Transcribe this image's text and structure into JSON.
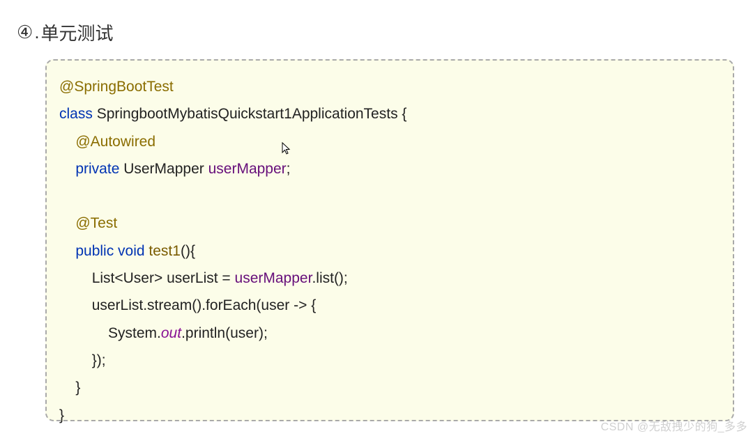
{
  "heading": {
    "number": "④",
    "dot": ".",
    "title": "单元测试"
  },
  "code": {
    "line1": {
      "annotation": "@SpringBootTest"
    },
    "line2": {
      "kw_class": "class",
      "classname": " SpringbootMybatisQuickstart1ApplicationTests {"
    },
    "line3": {
      "indent": "    ",
      "annotation": "@Autowired"
    },
    "line4": {
      "indent": "    ",
      "kw_private": "private",
      "type": " UserMapper ",
      "field": "userMapper",
      "end": ";"
    },
    "line5": {
      "indent": " "
    },
    "line6": {
      "indent": "    ",
      "annotation": "@Test"
    },
    "line7": {
      "indent": "    ",
      "kw_public": "public",
      "kw_void": " void ",
      "method": "test1",
      "end": "(){"
    },
    "line8": {
      "indent": "        ",
      "pre": "List<User> userList = ",
      "field": "userMapper",
      "post": ".list();"
    },
    "line9": {
      "indent": "        ",
      "text": "userList.stream().forEach(user -> {"
    },
    "line10": {
      "indent": "            ",
      "pre": "System.",
      "out": "out",
      "post": ".println(user);"
    },
    "line11": {
      "indent": "        ",
      "text": "});"
    },
    "line12": {
      "indent": "    ",
      "text": "}"
    },
    "line13": {
      "text": "}"
    }
  },
  "watermark": "CSDN @无敌拽少的狗_多多"
}
